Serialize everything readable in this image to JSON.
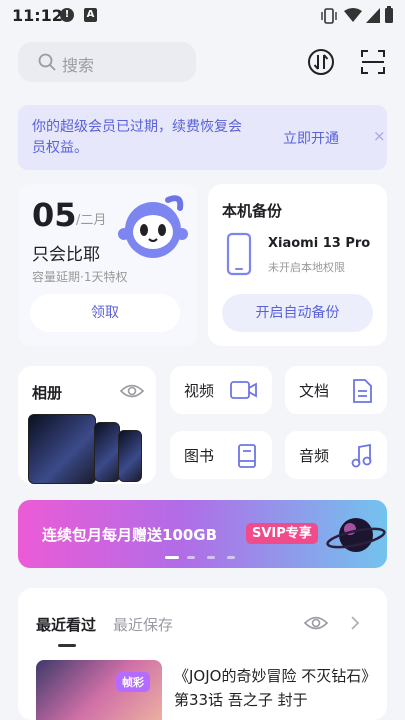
{
  "status": {
    "time": "11:12"
  },
  "search": {
    "placeholder": "搜索"
  },
  "vip_banner": {
    "message": "你的超级会员已过期，续费恢复会员权益。",
    "cta": "立即开通",
    "close": "×"
  },
  "vip_card": {
    "day": "05",
    "month": "/二月",
    "name": "只会比耶",
    "subtitle": "容量延期·1天特权",
    "button": "领取"
  },
  "backup_card": {
    "title": "本机备份",
    "device": "Xiaomi 13 Pro",
    "state": "未开启本地权限",
    "button": "开启自动备份"
  },
  "album": {
    "title": "相册"
  },
  "tiles": [
    {
      "label": "视频",
      "icon": "video-icon"
    },
    {
      "label": "文档",
      "icon": "document-icon"
    },
    {
      "label": "图书",
      "icon": "book-icon"
    },
    {
      "label": "音频",
      "icon": "music-icon"
    }
  ],
  "promo": {
    "text": "连续包月每月赠送100GB",
    "badge": "SVIP专享"
  },
  "recent": {
    "tabs": [
      "最近看过",
      "最近保存"
    ],
    "item": {
      "badge": "帧彩",
      "title": "《JOJO的奇妙冒险 不灭钻石》第33话 吾之子 封于"
    }
  },
  "colors": {
    "accent": "#5a62d8",
    "background": "#f4f5f8"
  }
}
